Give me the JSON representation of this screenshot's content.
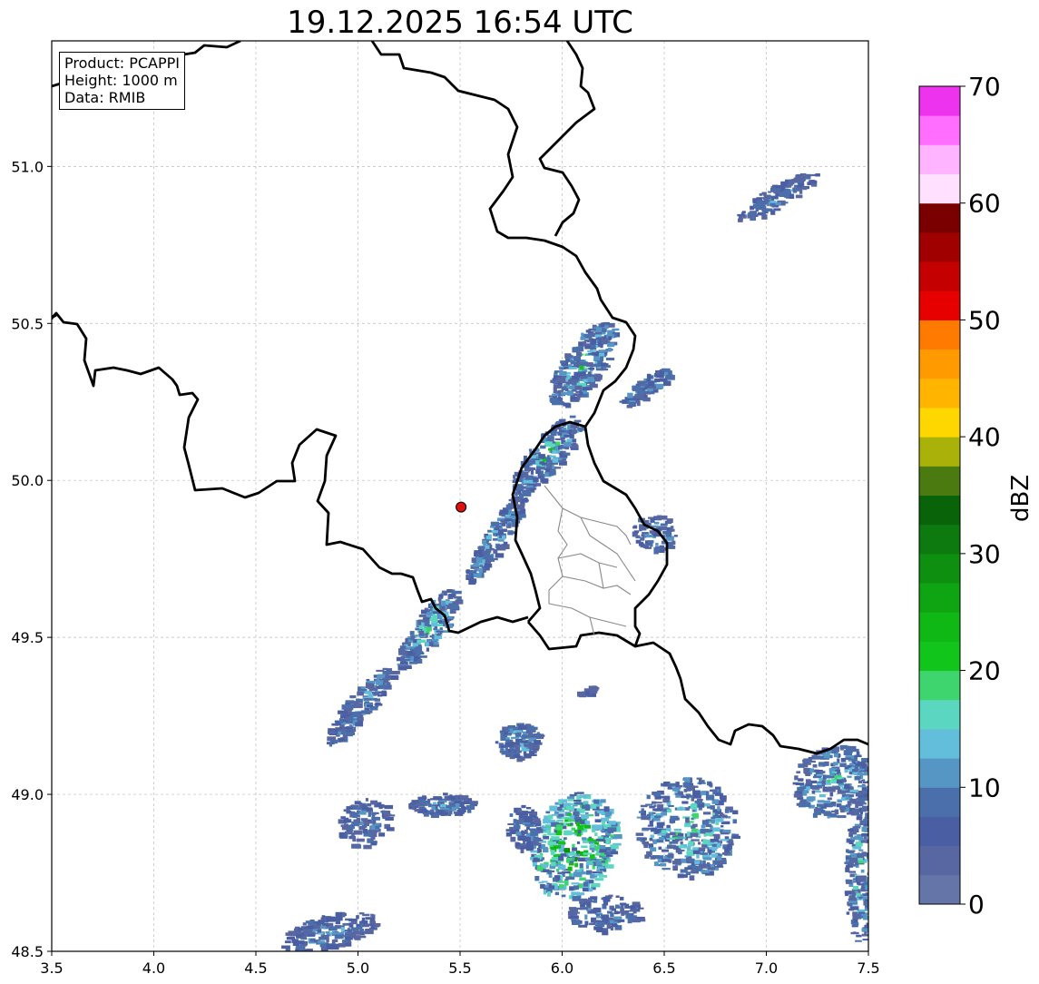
{
  "title": "19.12.2025 16:54 UTC",
  "info": {
    "product": "Product: PCAPPI",
    "height": "Height: 1000 m",
    "data": "Data: RMIB"
  },
  "axes": {
    "x_ticks": [
      "3.5",
      "4.0",
      "4.5",
      "5.0",
      "5.5",
      "6.0",
      "6.5",
      "7.0",
      "7.5"
    ],
    "y_ticks": [
      "48.5",
      "49.0",
      "49.5",
      "50.0",
      "50.5",
      "51.0"
    ],
    "xlim": [
      3.5,
      7.5
    ],
    "ylim": [
      48.5,
      51.4
    ],
    "grid": true
  },
  "radar_site": {
    "lon": 5.505,
    "lat": 49.915,
    "color": "#e01010"
  },
  "colorbar": {
    "label": "dBZ",
    "ticks": [
      "0",
      "10",
      "20",
      "30",
      "40",
      "50",
      "60",
      "70"
    ],
    "range": [
      0,
      70
    ],
    "step": 2.5,
    "colors": [
      "#6675a8",
      "#5867a2",
      "#4a5ea3",
      "#4a6faa",
      "#5696c4",
      "#63bedc",
      "#5bd7c1",
      "#3ed46e",
      "#12c51a",
      "#10b816",
      "#0fa512",
      "#0e8f10",
      "#0c7a0e",
      "#096309",
      "#4a7a10",
      "#aab20a",
      "#ffd700",
      "#ffb400",
      "#ff9b00",
      "#ff7a00",
      "#e60000",
      "#c40000",
      "#a00000",
      "#7a0000",
      "#ffe1ff",
      "#ffb4ff",
      "#ff6eff",
      "#ee33ee"
    ]
  },
  "colors": {
    "border": "#000000",
    "admin": "#888888",
    "grid": "#bbbbbb"
  }
}
